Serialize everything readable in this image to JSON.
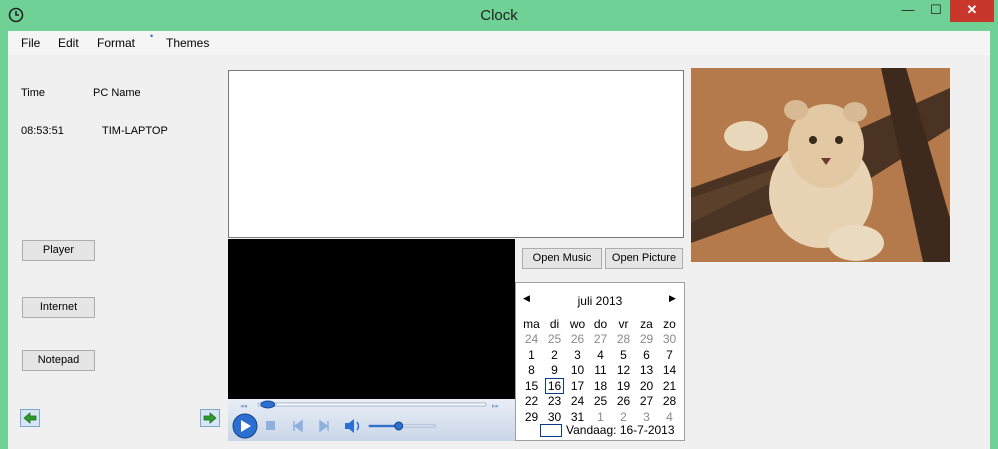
{
  "window": {
    "title": "Clock",
    "minimize": "—",
    "maximize": "☐",
    "close": "✕"
  },
  "menu": {
    "file": "File",
    "edit": "Edit",
    "format": "Format",
    "themes": "Themes"
  },
  "info": {
    "time_header": "Time",
    "pc_header": "PC Name",
    "time_value": "08:53:51",
    "pc_value": "TIM-LAPTOP"
  },
  "buttons": {
    "player": "Player",
    "internet": "Internet",
    "notepad": "Notepad",
    "open_music": "Open Music",
    "open_picture": "Open Picture"
  },
  "calendar": {
    "month": "juli 2013",
    "days": [
      "ma",
      "di",
      "wo",
      "do",
      "vr",
      "za",
      "zo"
    ],
    "weeks": [
      [
        "24",
        "25",
        "26",
        "27",
        "28",
        "29",
        "30"
      ],
      [
        "1",
        "2",
        "3",
        "4",
        "5",
        "6",
        "7"
      ],
      [
        "8",
        "9",
        "10",
        "11",
        "12",
        "13",
        "14"
      ],
      [
        "15",
        "16",
        "17",
        "18",
        "19",
        "20",
        "21"
      ],
      [
        "22",
        "23",
        "24",
        "25",
        "26",
        "27",
        "28"
      ],
      [
        "29",
        "30",
        "31",
        "1",
        "2",
        "3",
        "4"
      ]
    ],
    "other_month": [
      [
        0,
        0
      ],
      [
        0,
        1
      ],
      [
        0,
        2
      ],
      [
        0,
        3
      ],
      [
        0,
        4
      ],
      [
        0,
        5
      ],
      [
        0,
        6
      ],
      [
        5,
        3
      ],
      [
        5,
        4
      ],
      [
        5,
        5
      ],
      [
        5,
        6
      ]
    ],
    "selected": [
      3,
      1
    ],
    "today_label": "Vandaag: 16-7-2013"
  },
  "player": {
    "volume": 0.45,
    "seek": 0.03
  },
  "colors": {
    "titlebar": "#6fd195",
    "close": "#c9372c",
    "player_accent": "#2a6fd1"
  }
}
